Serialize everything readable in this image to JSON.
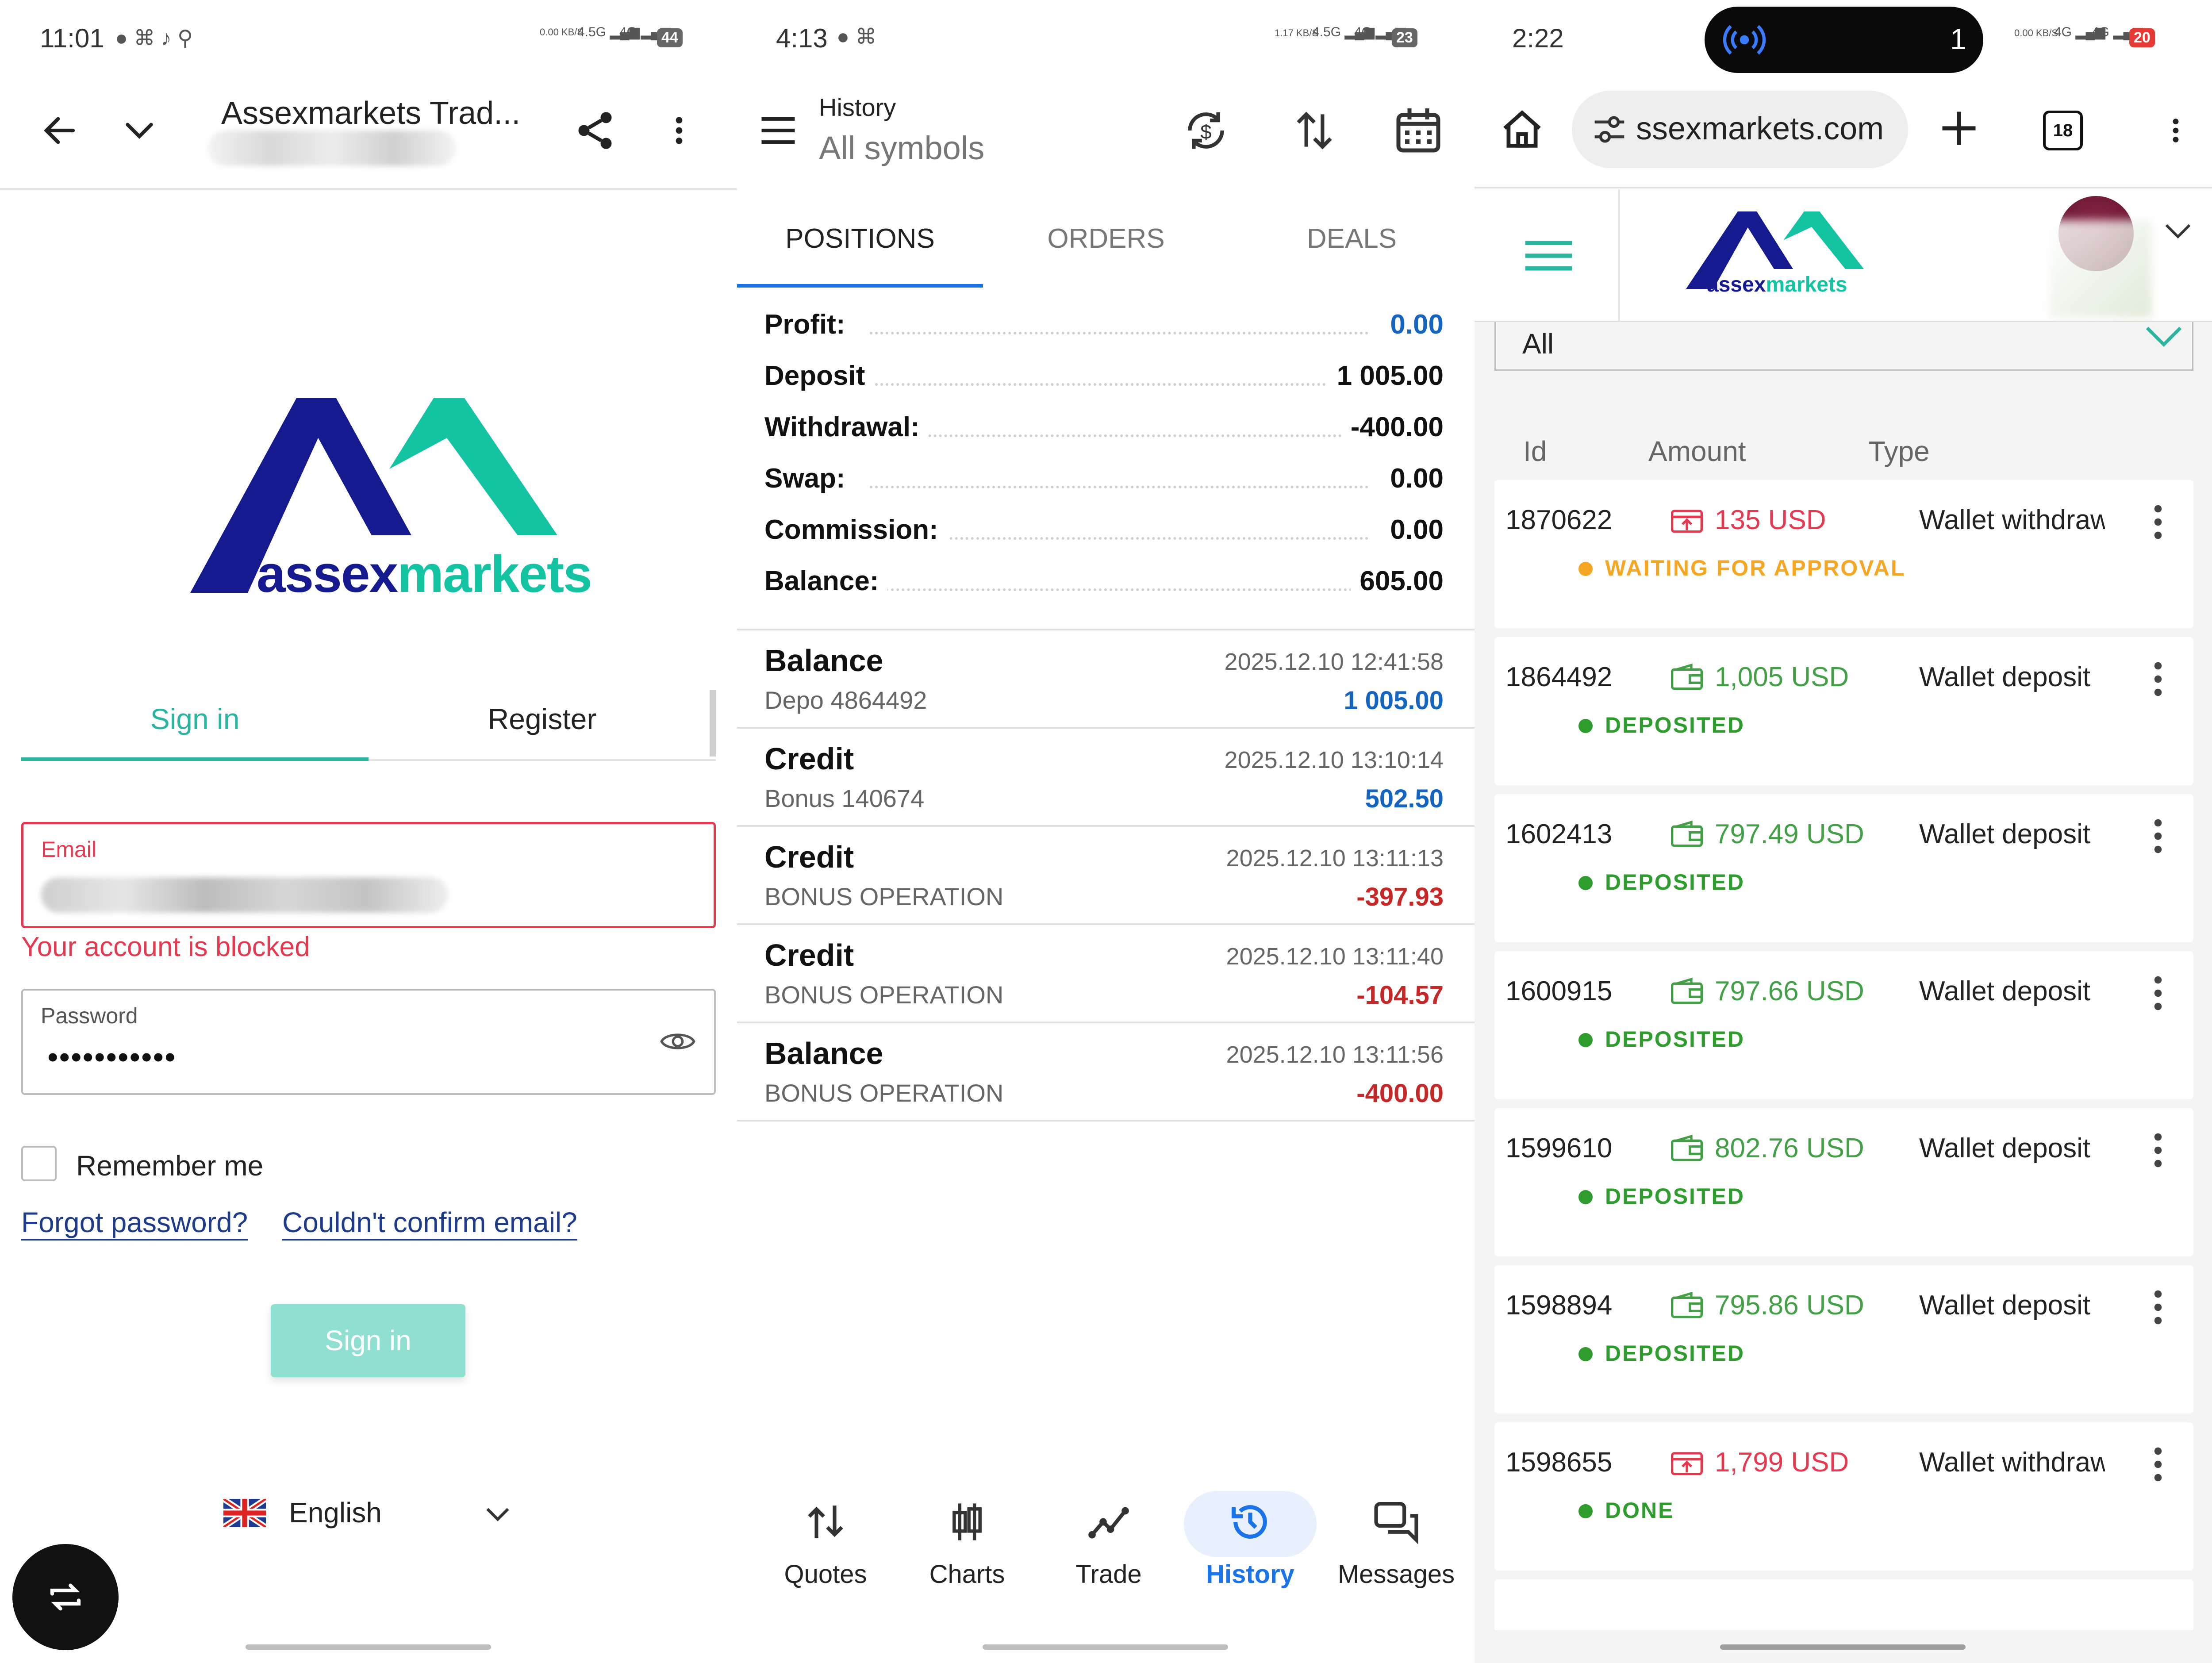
{
  "panel1": {
    "status": {
      "time": "11:01",
      "net_speed": "0.00 KB/S",
      "signal_a": "4.5G",
      "signal_b": "4G",
      "battery": "44"
    },
    "topbar": {
      "title": "Assexmarkets Trad...",
      "back_icon": "arrow-back-icon",
      "dropdown_icon": "chevron-down-icon",
      "share_icon": "share-icon",
      "menu_icon": "more-vert-icon"
    },
    "logo": {
      "text_a": "assex",
      "text_b": "markets"
    },
    "tabs": {
      "signin": "Sign in",
      "register": "Register"
    },
    "email": {
      "label": "Email",
      "error": "Your account is blocked"
    },
    "password": {
      "label": "Password",
      "value": "•••••••••••"
    },
    "remember": "Remember me",
    "links": {
      "forgot": "Forgot password?",
      "confirm": "Couldn't confirm email?"
    },
    "signin_button": "Sign in",
    "language": "English",
    "colors": {
      "accent": "#2bb5a0",
      "error": "#e53950",
      "navy": "#1a1a8c",
      "teal": "#12c2a0"
    }
  },
  "panel2": {
    "status": {
      "time": "4:13",
      "net_speed": "1.17 KB/S",
      "signal_a": "4.5G",
      "signal_b": "4G",
      "battery": "23"
    },
    "header": {
      "title": "History",
      "subtitle": "All symbols"
    },
    "tabs": [
      "POSITIONS",
      "ORDERS",
      "DEALS"
    ],
    "summary": [
      {
        "label": "Profit:",
        "value": "0.00",
        "blue": true
      },
      {
        "label": "Deposit",
        "value": "1 005.00",
        "blue": false
      },
      {
        "label": "Withdrawal:",
        "value": "-400.00",
        "blue": false
      },
      {
        "label": "Swap:",
        "value": "0.00",
        "blue": false
      },
      {
        "label": "Commission:",
        "value": "0.00",
        "blue": false
      },
      {
        "label": "Balance:",
        "value": "605.00",
        "blue": false
      }
    ],
    "entries": [
      {
        "type": "Balance",
        "desc": "Depo 4864492",
        "date": "2025.12.10 12:41:58",
        "amount": "1 005.00",
        "color": "blue"
      },
      {
        "type": "Credit",
        "desc": "Bonus 140674",
        "date": "2025.12.10 13:10:14",
        "amount": "502.50",
        "color": "blue"
      },
      {
        "type": "Credit",
        "desc": "BONUS OPERATION",
        "date": "2025.12.10 13:11:13",
        "amount": "-397.93",
        "color": "red"
      },
      {
        "type": "Credit",
        "desc": "BONUS OPERATION",
        "date": "2025.12.10 13:11:40",
        "amount": "-104.57",
        "color": "red"
      },
      {
        "type": "Balance",
        "desc": "BONUS OPERATION",
        "date": "2025.12.10 13:11:56",
        "amount": "-400.00",
        "color": "red"
      }
    ],
    "nav": [
      "Quotes",
      "Charts",
      "Trade",
      "History",
      "Messages"
    ],
    "colors": {
      "blue": "#1565c0",
      "red": "#c62828",
      "active": "#1a73e8"
    }
  },
  "panel3": {
    "status": {
      "time": "2:22",
      "call_count": "1",
      "net_speed": "0.00 KB/S",
      "signal_a": "4G",
      "signal_b": "4G",
      "battery": "20"
    },
    "browser": {
      "url": "ssexmarkets.com",
      "tabs_count": "18"
    },
    "logo": {
      "text_a": "assex",
      "text_b": "markets"
    },
    "filter": "All",
    "columns": [
      "Id",
      "Amount",
      "Type"
    ],
    "rows": [
      {
        "id": "1870622",
        "amount": "135 USD",
        "type": "Wallet withdraw",
        "status": "WAITING FOR APPROVAL",
        "kind": "withdraw",
        "state": "waiting"
      },
      {
        "id": "1864492",
        "amount": "1,005 USD",
        "type": "Wallet deposit",
        "status": "DEPOSITED",
        "kind": "deposit",
        "state": "ok"
      },
      {
        "id": "1602413",
        "amount": "797.49 USD",
        "type": "Wallet deposit",
        "status": "DEPOSITED",
        "kind": "deposit",
        "state": "ok"
      },
      {
        "id": "1600915",
        "amount": "797.66 USD",
        "type": "Wallet deposit",
        "status": "DEPOSITED",
        "kind": "deposit",
        "state": "ok"
      },
      {
        "id": "1599610",
        "amount": "802.76 USD",
        "type": "Wallet deposit",
        "status": "DEPOSITED",
        "kind": "deposit",
        "state": "ok"
      },
      {
        "id": "1598894",
        "amount": "795.86 USD",
        "type": "Wallet deposit",
        "status": "DEPOSITED",
        "kind": "deposit",
        "state": "ok"
      },
      {
        "id": "1598655",
        "amount": "1,799 USD",
        "type": "Wallet withdraw",
        "status": "DONE",
        "kind": "withdraw",
        "state": "ok"
      }
    ],
    "colors": {
      "green": "#43a047",
      "red": "#e53950",
      "amber": "#f5a623",
      "status_green": "#2e9d2e"
    }
  }
}
